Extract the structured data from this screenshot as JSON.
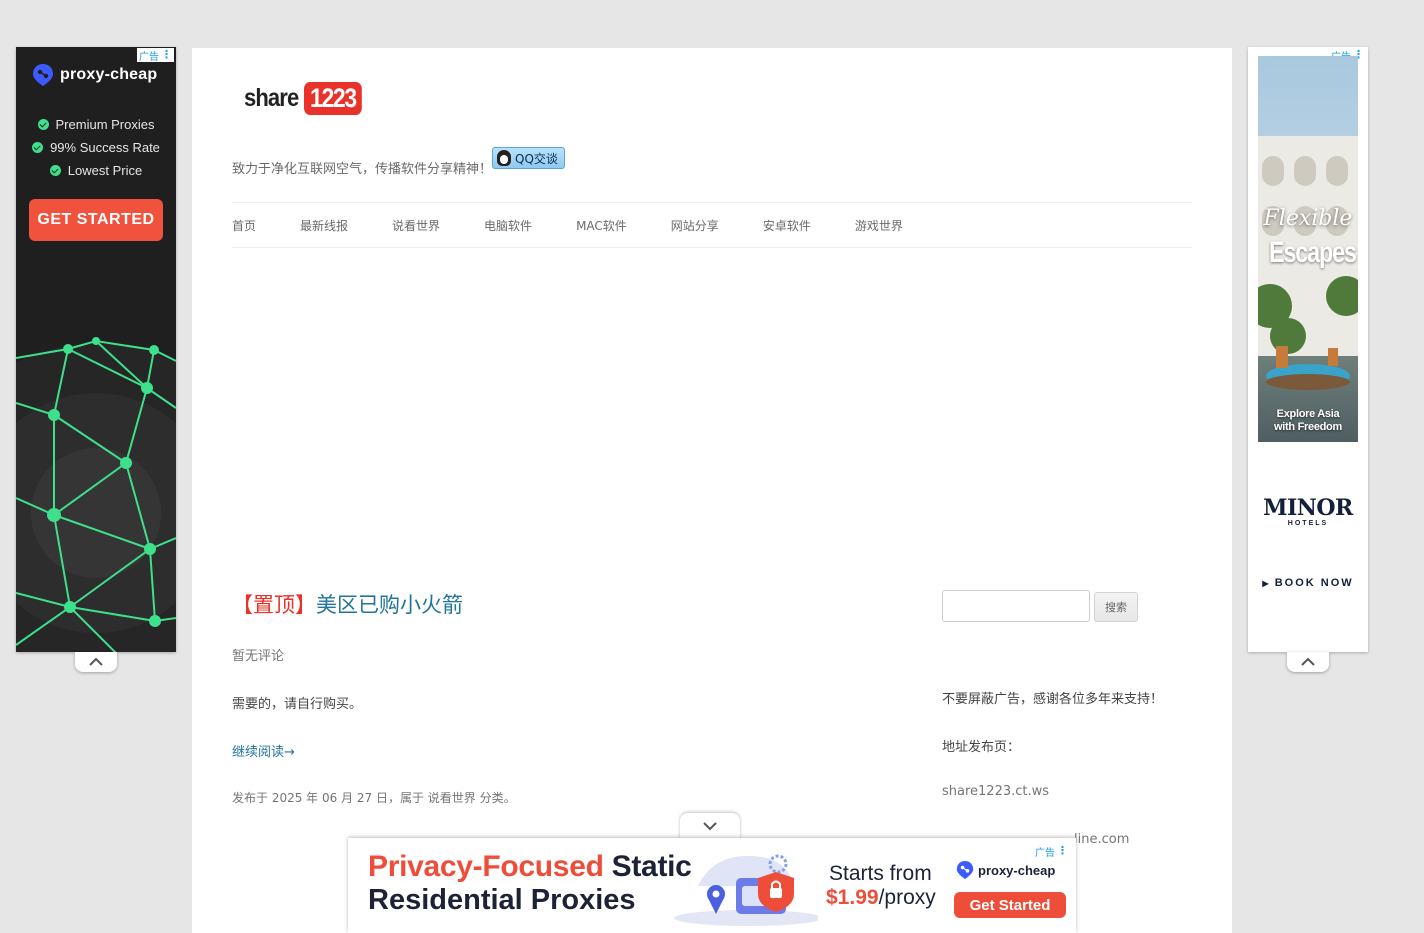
{
  "ads": {
    "ad_label": "广告",
    "left": {
      "brand": "proxy-cheap",
      "features": [
        "Premium Proxies",
        "99% Success Rate",
        "Lowest Price"
      ],
      "cta": "GET STARTED"
    },
    "right": {
      "headline_script": "Flexible",
      "headline_bold": "Escapes",
      "sub_line1": "Explore Asia",
      "sub_line2": "with Freedom",
      "brand": "MINOR",
      "brand_sub": "HOTELS",
      "cta": "BOOK NOW"
    },
    "bottom": {
      "line1_highlight": "Privacy-Focused",
      "line1_rest": "Static",
      "line2": "Residential Proxies",
      "starts_from": "Starts from",
      "price": "$1.99",
      "price_unit": "/proxy",
      "brand": "proxy-cheap",
      "cta": "Get Started"
    }
  },
  "site": {
    "logo_text": "share",
    "logo_number": "1223",
    "tagline": "致力于净化互联网空气，传播软件分享精神！",
    "qq_button": "QQ交谈"
  },
  "nav": {
    "items": [
      "首页",
      "最新线报",
      "说看世界",
      "电脑软件",
      "MAC软件",
      "网站分享",
      "安卓软件",
      "游戏世界"
    ]
  },
  "post": {
    "pin_label": "【置顶】",
    "title": "美区已购小火箭",
    "comments": "暂无评论",
    "body": "需要的，请自行购买。",
    "read_more": "继续阅读→",
    "date_line": "发布于 2025 年 06 月 27 日，属于 说看世界 分类。"
  },
  "sidebar": {
    "search_button": "搜索",
    "search_value": "",
    "notice": "不要屏蔽广告，感谢各位多年来支持！",
    "address_label": "地址发布页：",
    "link1": "share1223.ct.ws",
    "link2_partial": "line.com"
  },
  "colors": {
    "accent_link": "#21759b",
    "pin_red": "#e8322a",
    "ad_cta": "#f0523d",
    "network_green": "#3ee08c"
  }
}
